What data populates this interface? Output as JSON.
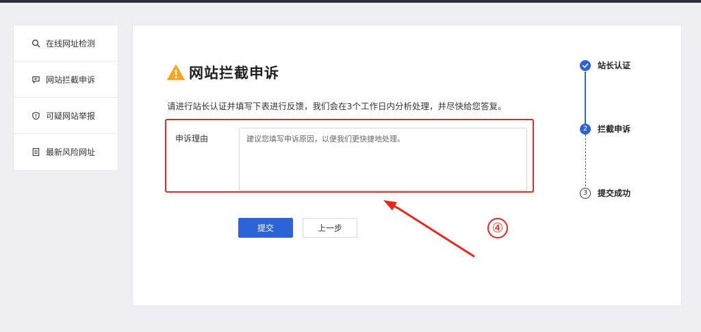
{
  "sidebar": {
    "items": [
      {
        "label": "在线网址检测",
        "icon": "search-icon"
      },
      {
        "label": "网站拦截申诉",
        "icon": "comment-icon"
      },
      {
        "label": "可疑网站举报",
        "icon": "shield-icon"
      },
      {
        "label": "最新风险网址",
        "icon": "document-icon"
      }
    ]
  },
  "main": {
    "title": "网站拦截申诉",
    "description": "请进行站长认证并填写下表进行反馈，我们会在3个工作日内分析处理，并尽快给您答复。",
    "form": {
      "label": "申诉理由",
      "placeholder": "建议您填写申诉原因，以便我们更快捷地处理。",
      "value": ""
    },
    "buttons": {
      "submit": "提交",
      "prev": "上一步"
    },
    "annotation": "④"
  },
  "steps": [
    {
      "number": "1",
      "label": "站长认证",
      "status": "done"
    },
    {
      "number": "2",
      "label": "拦截申诉",
      "status": "active"
    },
    {
      "number": "3",
      "label": "提交成功",
      "status": "todo"
    }
  ],
  "colors": {
    "accent": "#2c63d6",
    "highlight": "#f0221a",
    "warning": "#f5a623"
  }
}
